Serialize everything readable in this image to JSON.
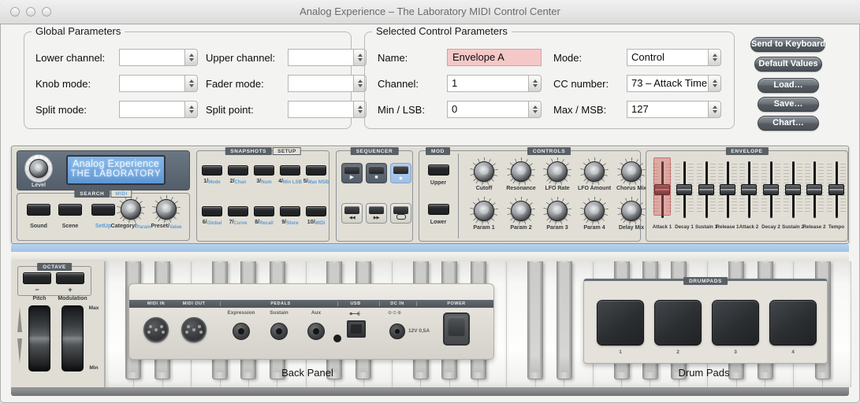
{
  "window": {
    "title": "Analog Experience – The Laboratory MIDI Control Center"
  },
  "colors": {
    "accent_blue": "#5b9bd5",
    "selected_pink": "#f5c8c8",
    "lcd_blue": "#6aa3dd"
  },
  "global_parameters": {
    "title": "Global Parameters",
    "fields": [
      {
        "label": "Lower channel:",
        "value": ""
      },
      {
        "label": "Upper channel:",
        "value": ""
      },
      {
        "label": "Knob mode:",
        "value": ""
      },
      {
        "label": "Fader mode:",
        "value": ""
      },
      {
        "label": "Split mode:",
        "value": ""
      },
      {
        "label": "Split point:",
        "value": ""
      }
    ]
  },
  "selected_control_parameters": {
    "title": "Selected Control Parameters",
    "fields": [
      {
        "label": "Name:",
        "value": "Envelope A",
        "style": "name"
      },
      {
        "label": "Mode:",
        "value": "Control",
        "style": "spin"
      },
      {
        "label": "Channel:",
        "value": "1",
        "style": "spin"
      },
      {
        "label": "CC number:",
        "value": "73 – Attack Time",
        "style": "spin"
      },
      {
        "label": "Min / LSB:",
        "value": "0",
        "style": "spin"
      },
      {
        "label": "Max / MSB:",
        "value": "127",
        "style": "spin"
      }
    ]
  },
  "action_buttons": [
    {
      "label": "Send to Keyboard"
    },
    {
      "label": "Default Values"
    },
    {
      "label": "Load…"
    },
    {
      "label": "Save…"
    },
    {
      "label": "Chart…"
    }
  ],
  "device": {
    "level_label": "Level",
    "lcd_line1": "Analog Experience",
    "lcd_line2": "THE LABORATORY",
    "search": {
      "header_primary": "SEARCH",
      "header_secondary": "MIDI",
      "buttons": [
        {
          "label": "Sound",
          "accent": false
        },
        {
          "label": "Scene",
          "accent": false
        },
        {
          "label": "SetUp",
          "accent": true
        }
      ],
      "knobs": [
        {
          "label": "Category/",
          "sub": "Param"
        },
        {
          "label": "Preset/",
          "sub": "Value"
        }
      ]
    },
    "snapshots": {
      "header_primary": "SNAPSHOTS",
      "header_secondary": "SETUP",
      "buttons": [
        {
          "num": "1/",
          "sub": "Mode"
        },
        {
          "num": "2/",
          "sub": "Chan"
        },
        {
          "num": "3/",
          "sub": "Num"
        },
        {
          "num": "4/",
          "sub": "Min LSB"
        },
        {
          "num": "5/",
          "sub": "Max MSB"
        },
        {
          "num": "6/",
          "sub": "Global"
        },
        {
          "num": "7/",
          "sub": "Curve"
        },
        {
          "num": "8/",
          "sub": "Recall"
        },
        {
          "num": "9/",
          "sub": "Store"
        },
        {
          "num": "10/",
          "sub": "MIDI"
        }
      ]
    },
    "sequencer": {
      "header": "SEQUENCER",
      "transport": [
        "play",
        "stop",
        "record"
      ],
      "active": "record",
      "nav": [
        "rewind",
        "forward",
        "loop"
      ]
    },
    "mod": {
      "header": "MOD",
      "buttons": [
        "Upper",
        "Lower"
      ]
    },
    "controls": {
      "header": "CONTROLS",
      "knobs": [
        "Cutoff",
        "Resonance",
        "LFO Rate",
        "LFO Amount",
        "Chorus Mix",
        "Param 1",
        "Param 2",
        "Param 3",
        "Param 4",
        "Delay Mix"
      ]
    },
    "envelope": {
      "header": "ENVELOPE",
      "sliders": [
        "Attack 1",
        "Decay 1",
        "Sustain 1",
        "Release 1",
        "Attack 2",
        "Decay 2",
        "Sustain 2",
        "Release 2",
        "Tempo"
      ],
      "selected": "Attack 1"
    }
  },
  "keyboard": {
    "octave": {
      "header": "OCTAVE",
      "minus": "−",
      "plus": "+",
      "wheel1": "Pitch",
      "wheel2": "Modulation",
      "max": "Max",
      "min": "Min"
    },
    "back_panel": {
      "caption": "Back Panel",
      "strip_labels": [
        "MIDI IN",
        "MIDI OUT",
        "PEDALS",
        "USB",
        "DC IN",
        "POWER"
      ],
      "pedal_labels": [
        "Expression",
        "Sustain",
        "Aux"
      ],
      "dc_rating": "12V 0,5A"
    },
    "drum_pads": {
      "caption": "Drum Pads",
      "header": "DRUMPADS",
      "pad_numbers": [
        "1",
        "2",
        "3",
        "4"
      ]
    }
  }
}
